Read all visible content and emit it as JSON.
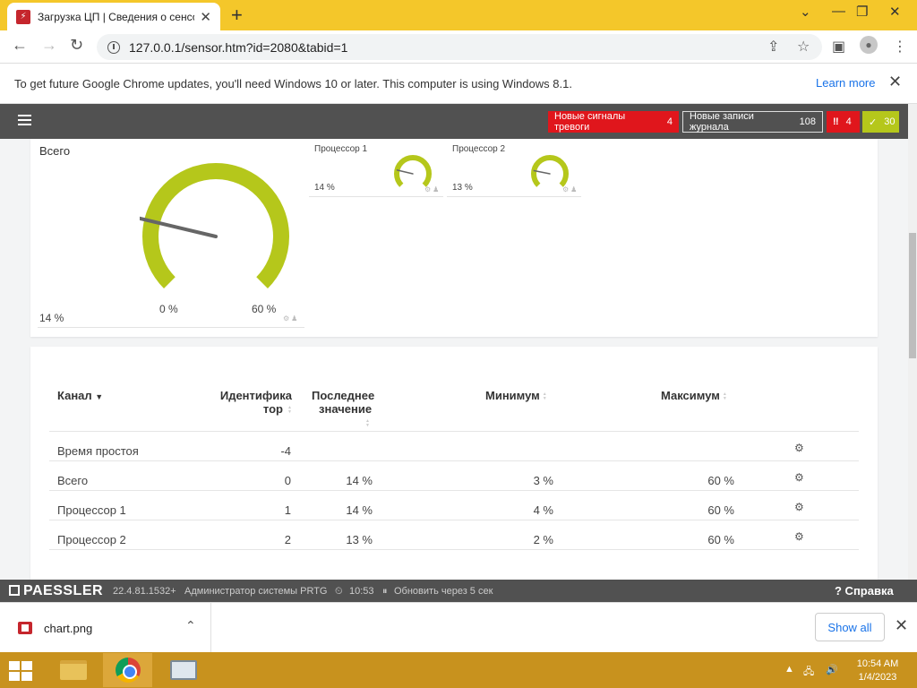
{
  "browser": {
    "tab_title": "Загрузка ЦП | Сведения о сенсоре",
    "tab_favicon": "prtg-favicon",
    "url": "127.0.0.1/sensor.htm?id=2080&tabid=1",
    "new_tab_symbol": "+",
    "close_symbol": "✕",
    "win_minimize": "⌄",
    "win_min": "—",
    "win_max": "❐",
    "win_close": "✕"
  },
  "infobar": {
    "message": "To get future Google Chrome updates, you'll need Windows 10 or later. This computer is using Windows 8.1.",
    "learn_more": "Learn more",
    "close": "✕"
  },
  "prtg_header": {
    "new_alarms_label": "Новые сигналы тревоги",
    "new_alarms_count": "4",
    "new_log_label": "Новые записи журнала",
    "new_log_count": "108",
    "down_icon": "‼",
    "down_count": "4",
    "up_icon": "✓",
    "up_count": "30",
    "colors": {
      "alarm": "#e0161c",
      "ok": "#b5c71b",
      "header": "#515151"
    }
  },
  "gauges": {
    "total": {
      "title": "Всего",
      "value": "14 %",
      "min_label": "0 %",
      "max_label": "60 %",
      "value_pct": 14,
      "max_pct": 60
    },
    "cpu1": {
      "title": "Процессор 1",
      "value": "14 %",
      "value_pct": 14
    },
    "cpu2": {
      "title": "Процессор 2",
      "value": "13 %",
      "value_pct": 13
    },
    "gauge_color": "#b5c71b"
  },
  "table": {
    "headers": {
      "channel": "Канал",
      "id_line1": "Идентифика",
      "id_line2": "тор",
      "last_line1": "Последнее",
      "last_line2": "значение",
      "min": "Минимум",
      "max": "Максимум"
    },
    "rows": [
      {
        "channel": "Время простоя",
        "id": "-4",
        "last": "",
        "min": "",
        "max": ""
      },
      {
        "channel": "Всего",
        "id": "0",
        "last": "14 %",
        "min": "3 %",
        "max": "60 %"
      },
      {
        "channel": "Процессор 1",
        "id": "1",
        "last": "14 %",
        "min": "4 %",
        "max": "60 %"
      },
      {
        "channel": "Процессор 2",
        "id": "2",
        "last": "13 %",
        "min": "2 %",
        "max": "60 %"
      }
    ]
  },
  "footer": {
    "logo": "PAESSLER",
    "version": "22.4.81.1532+",
    "user": "Администратор системы PRTG",
    "time": "10:53",
    "refresh": "Обновить через 5 сек",
    "help": "? Справка"
  },
  "download": {
    "file_name": "chart.png",
    "show_all": "Show all",
    "close": "✕"
  },
  "taskbar": {
    "time": "10:54 AM",
    "date": "1/4/2023"
  }
}
